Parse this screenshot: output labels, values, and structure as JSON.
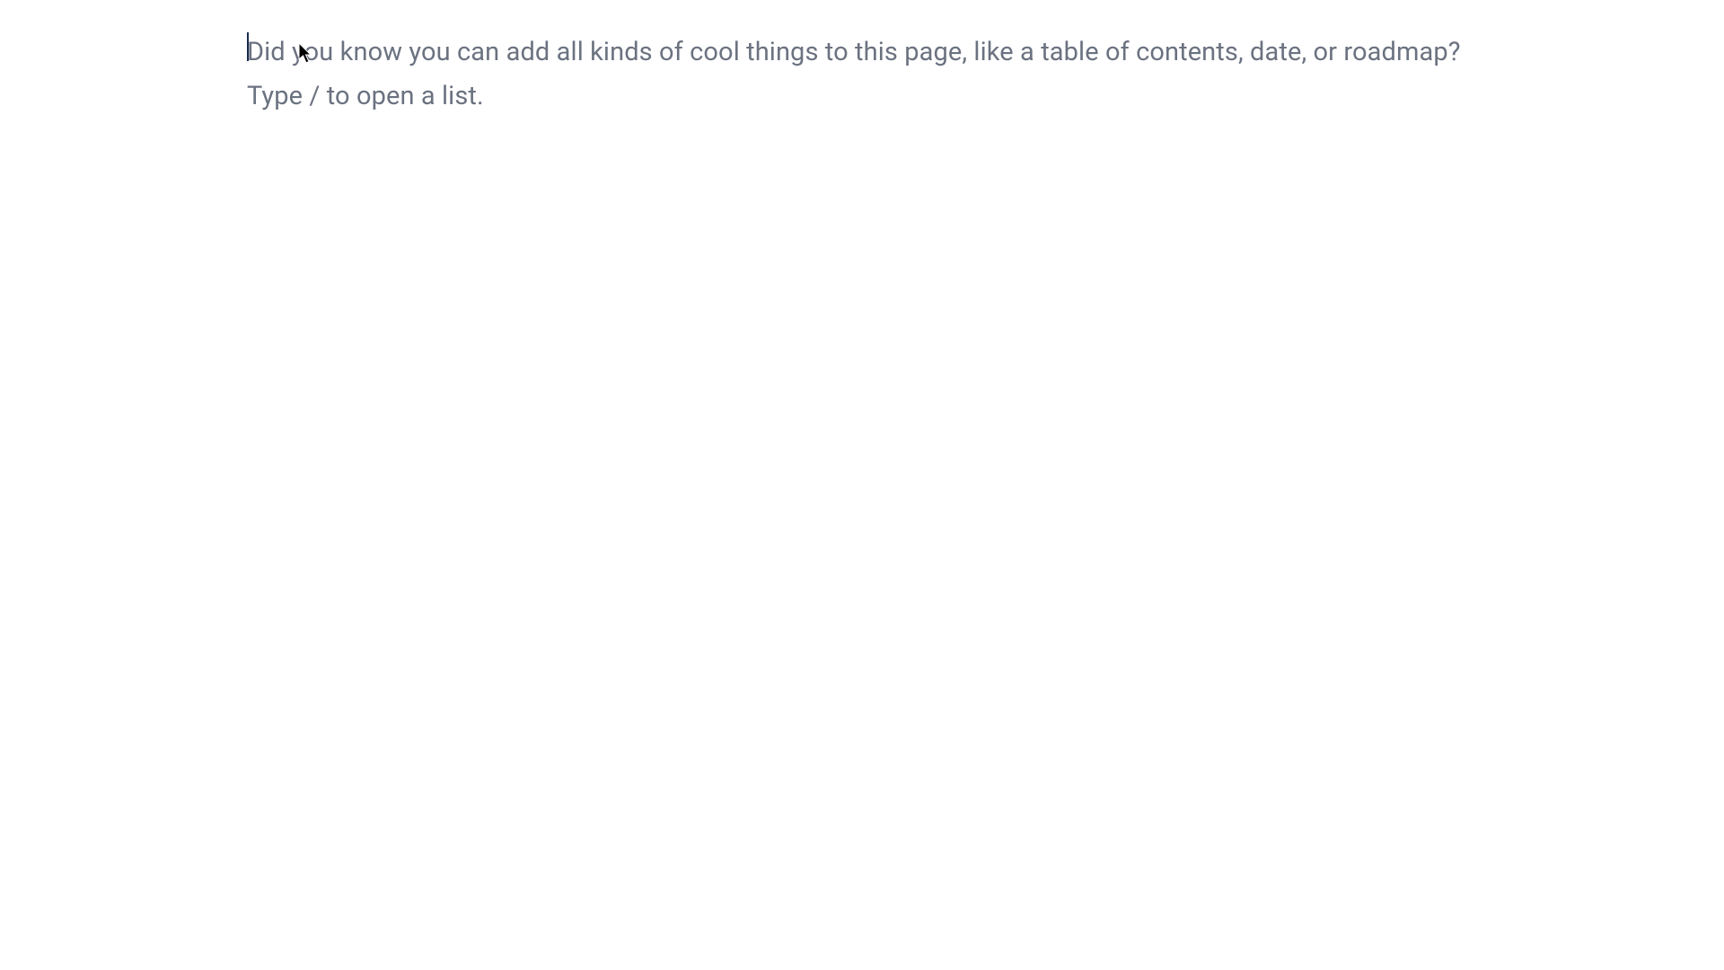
{
  "editor": {
    "placeholder": "Did you know you can add all kinds of cool things to this page, like a table of contents, date, or roadmap?\nType / to open a list."
  }
}
